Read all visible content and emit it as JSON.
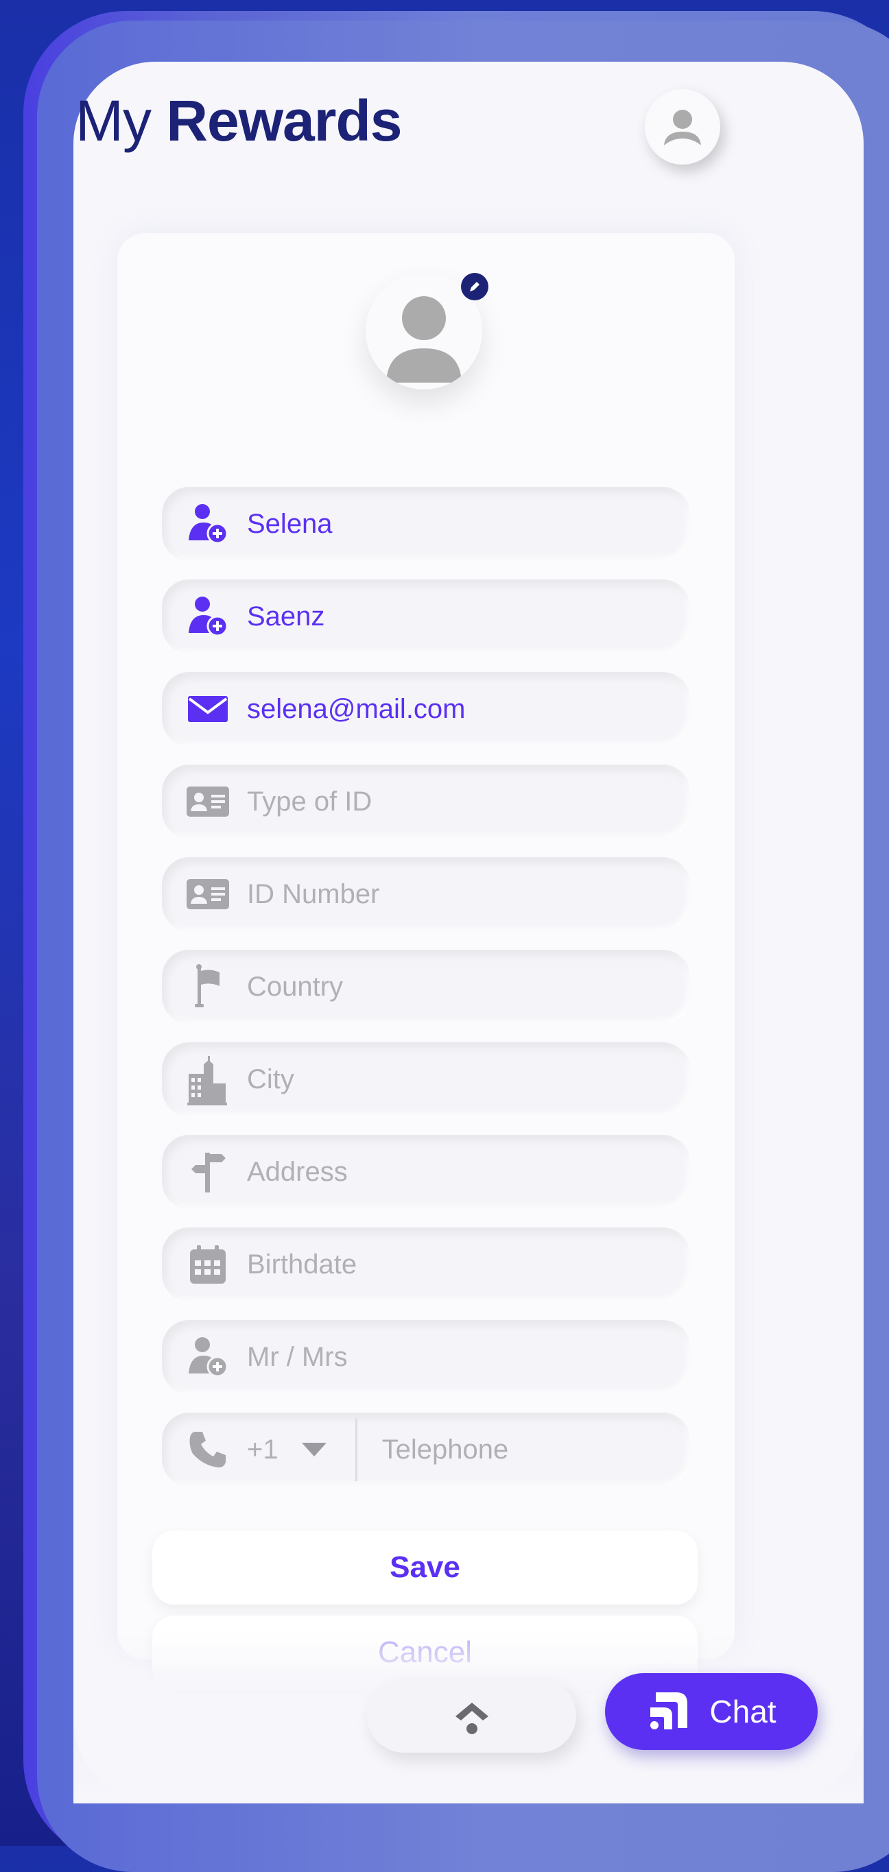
{
  "header": {
    "title_prefix": "My",
    "title_bold": "Rewards"
  },
  "form": {
    "first_name": "Selena",
    "last_name": "Saenz",
    "email": "selena@mail.com",
    "id_type_placeholder": "Type of ID",
    "id_number_placeholder": "ID Number",
    "country_placeholder": "Country",
    "city_placeholder": "City",
    "address_placeholder": "Address",
    "birthdate_placeholder": "Birthdate",
    "title_placeholder": "Mr / Mrs",
    "phone_code": "+1",
    "telephone_placeholder": "Telephone"
  },
  "actions": {
    "save_label": "Save",
    "cancel_label": "Cancel",
    "chat_label": "Chat"
  },
  "colors": {
    "accent": "#5b30f2",
    "navy": "#1c2276",
    "placeholder": "#b0b0b6"
  }
}
